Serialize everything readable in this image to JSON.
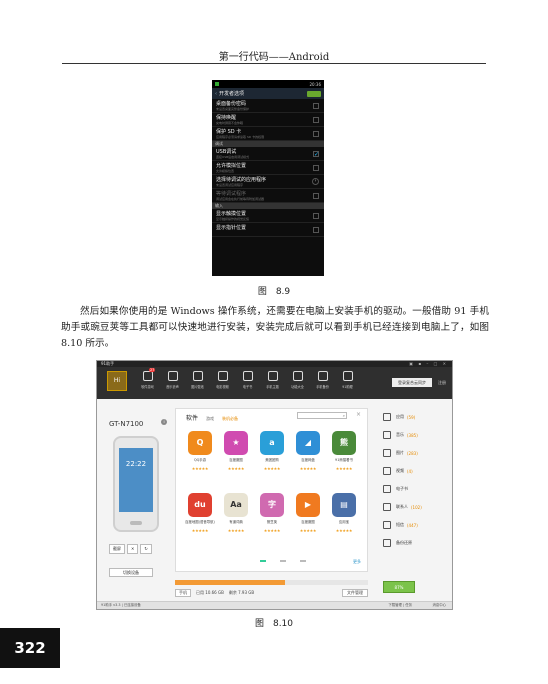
{
  "header": {
    "title": "第一行代码——Android"
  },
  "phone": {
    "status_time": "20:36",
    "title": "开发者选项",
    "rows": [
      {
        "title": "桌面备份密码",
        "sub": "未设置桌面完整备份保护",
        "control": "checkbox"
      },
      {
        "title": "保持唤醒",
        "sub": "充电时屏幕不会休眠",
        "control": "checkbox"
      },
      {
        "title": "保护 SD 卡",
        "sub": "应用程序必须请求读取 SD 卡的权限",
        "control": "checkbox"
      },
      {
        "section": "调试"
      },
      {
        "title": "USB调试",
        "sub": "连接USB后启用调试模式",
        "control": "checked"
      },
      {
        "title": "允许模拟位置",
        "sub": "允许模拟位置",
        "control": "checkbox"
      },
      {
        "title": "选择待调试的应用程序",
        "sub": "未设置调试应用程序",
        "control": "arrow"
      },
      {
        "title": "等待调试程序",
        "sub": "调试应用会在执行前等待附加调试器",
        "control": "checkbox",
        "dim": true
      },
      {
        "section": "输入"
      },
      {
        "title": "显示触摸位置",
        "sub": "显示触摸操作的视觉反馈",
        "control": "checkbox"
      },
      {
        "title": "显示指针位置",
        "sub": "",
        "control": "checkbox"
      }
    ]
  },
  "caption1": "图　8.9",
  "paragraph": "然后如果你使用的是 Windows 操作系统，还需要在电脑上安装手机的驱动。一般借助 91 手机助手或豌豆荚等工具都可以快速地进行安装，安装完成后就可以看到手机已经连接到电脑上了，如图 8.10 所示。",
  "app": {
    "title": "91助手",
    "nav": [
      {
        "label": "软件游戏",
        "badge": "27"
      },
      {
        "label": "音乐铃声"
      },
      {
        "label": "图片壁纸"
      },
      {
        "label": "电影视频"
      },
      {
        "label": "电子书"
      },
      {
        "label": "手机主题"
      },
      {
        "label": "功能大全"
      },
      {
        "label": "手机备份"
      },
      {
        "label": "91助理"
      }
    ],
    "login": "登录复合云同步",
    "login2": "注册",
    "device_name": "GT-N7100",
    "device_time": "22:22",
    "device_controls": [
      "截屏",
      "✕",
      "↻"
    ],
    "device_button": "切换设备",
    "tabs": {
      "soft": "软件",
      "game": "游戏",
      "featured": "装机必备"
    },
    "apps": [
      {
        "name": "QQ手游",
        "color": "#f08a1c",
        "glyph": "Q"
      },
      {
        "name": "百度魔图",
        "color": "#d04bb0",
        "glyph": "★"
      },
      {
        "name": "美团团购",
        "color": "#2a9fd8",
        "glyph": "a"
      },
      {
        "name": "百度网盘",
        "color": "#2f8fd6",
        "glyph": "◢"
      },
      {
        "name": "91熊猫看书",
        "color": "#4a8a3a",
        "glyph": "熊"
      },
      {
        "name": "百度地图(语音导航)",
        "color": "#e04030",
        "glyph": "du"
      },
      {
        "name": "有道词典",
        "color": "#e8e3d2",
        "glyph": "Aa"
      },
      {
        "name": "豌豆荚",
        "color": "#d06ab0",
        "glyph": "字"
      },
      {
        "name": "百度魔图",
        "color": "#f07a20",
        "glyph": "▶"
      },
      {
        "name": "应用宝",
        "color": "#4a6fa8",
        "glyph": "▤"
      }
    ],
    "more": "更多",
    "categories": [
      {
        "label": "应用",
        "count": "(59)"
      },
      {
        "label": "音乐",
        "count": "(385)"
      },
      {
        "label": "图片",
        "count": "(283)"
      },
      {
        "label": "视频",
        "count": "(4)"
      },
      {
        "label": "电子书",
        "count": ""
      },
      {
        "label": "联系人",
        "count": "(102)"
      },
      {
        "label": "短信",
        "count": "(447)"
      },
      {
        "label": "备份还原",
        "count": ""
      }
    ],
    "storage": {
      "location": "手机",
      "used": "已用 10.66 GB",
      "free": "剩余 7.93 GB",
      "button": "文件管理",
      "used_fraction": 0.57
    },
    "battery": "87%",
    "footer": "91助手 v3.3 | 已连接设备",
    "footer_right": "消息中心",
    "footer_mid": "下载管理 | 任务"
  },
  "caption2": "图　8.10",
  "page_number": "322"
}
